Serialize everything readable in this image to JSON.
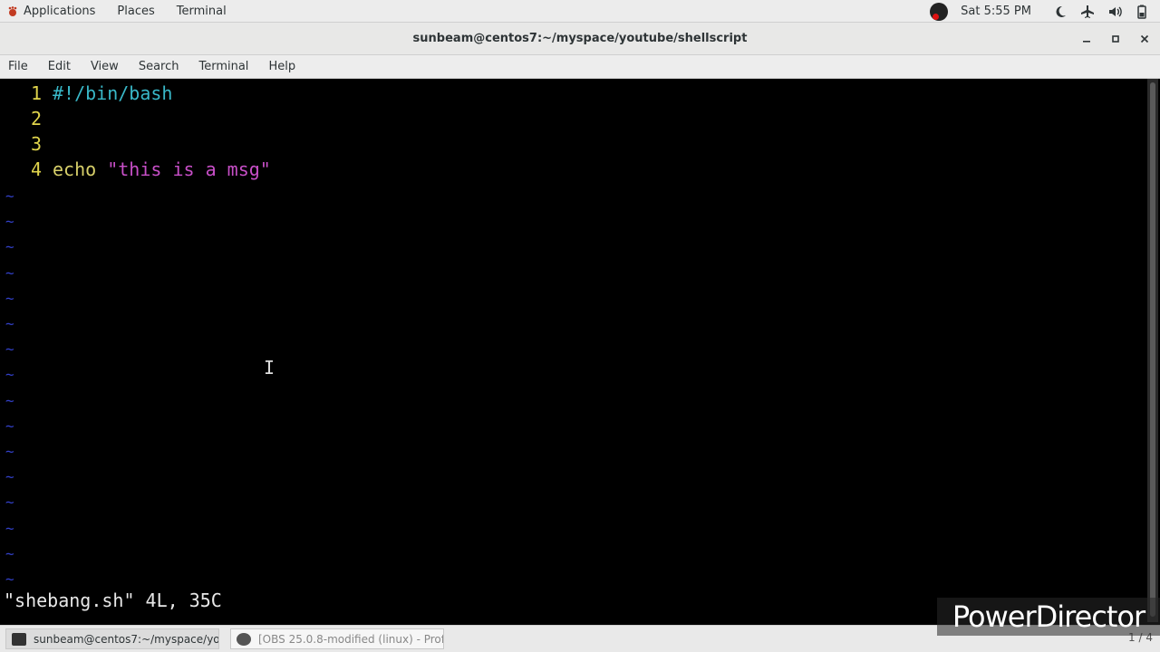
{
  "topbar": {
    "menus": [
      "Applications",
      "Places",
      "Terminal"
    ],
    "clock": "Sat  5:55 PM",
    "tray_icons": [
      "obs-icon",
      "night-light-icon",
      "airplane-mode-icon",
      "volume-icon",
      "battery-icon"
    ]
  },
  "window": {
    "title": "sunbeam@centos7:~/myspace/youtube/shellscript",
    "menu": [
      "File",
      "Edit",
      "View",
      "Search",
      "Terminal",
      "Help"
    ]
  },
  "editor": {
    "lines": [
      {
        "num": "1",
        "parts": [
          {
            "text": "#!/bin/bash",
            "kind": "comment"
          }
        ]
      },
      {
        "num": "2",
        "parts": []
      },
      {
        "num": "3",
        "parts": []
      },
      {
        "num": "4",
        "parts": [
          {
            "text": "echo ",
            "kind": "cmd"
          },
          {
            "text": "\"this is a msg\"",
            "kind": "str"
          }
        ]
      }
    ],
    "tilde": "~",
    "status": "\"shebang.sh\" 4L, 35C"
  },
  "taskbar": {
    "tasks": [
      {
        "label": "sunbeam@centos7:~/myspace/yout...",
        "active": true
      },
      {
        "label": "[OBS 25.0.8-modified (linux) - Profil...",
        "active": false
      }
    ],
    "pager": "1 / 4"
  },
  "watermark": "PowerDirector",
  "colors": {
    "comment": "#39b8c8",
    "cmd": "#d8d06a",
    "string": "#c84fc8",
    "line_number": "#e0d44c",
    "tilde": "#3240c8"
  }
}
